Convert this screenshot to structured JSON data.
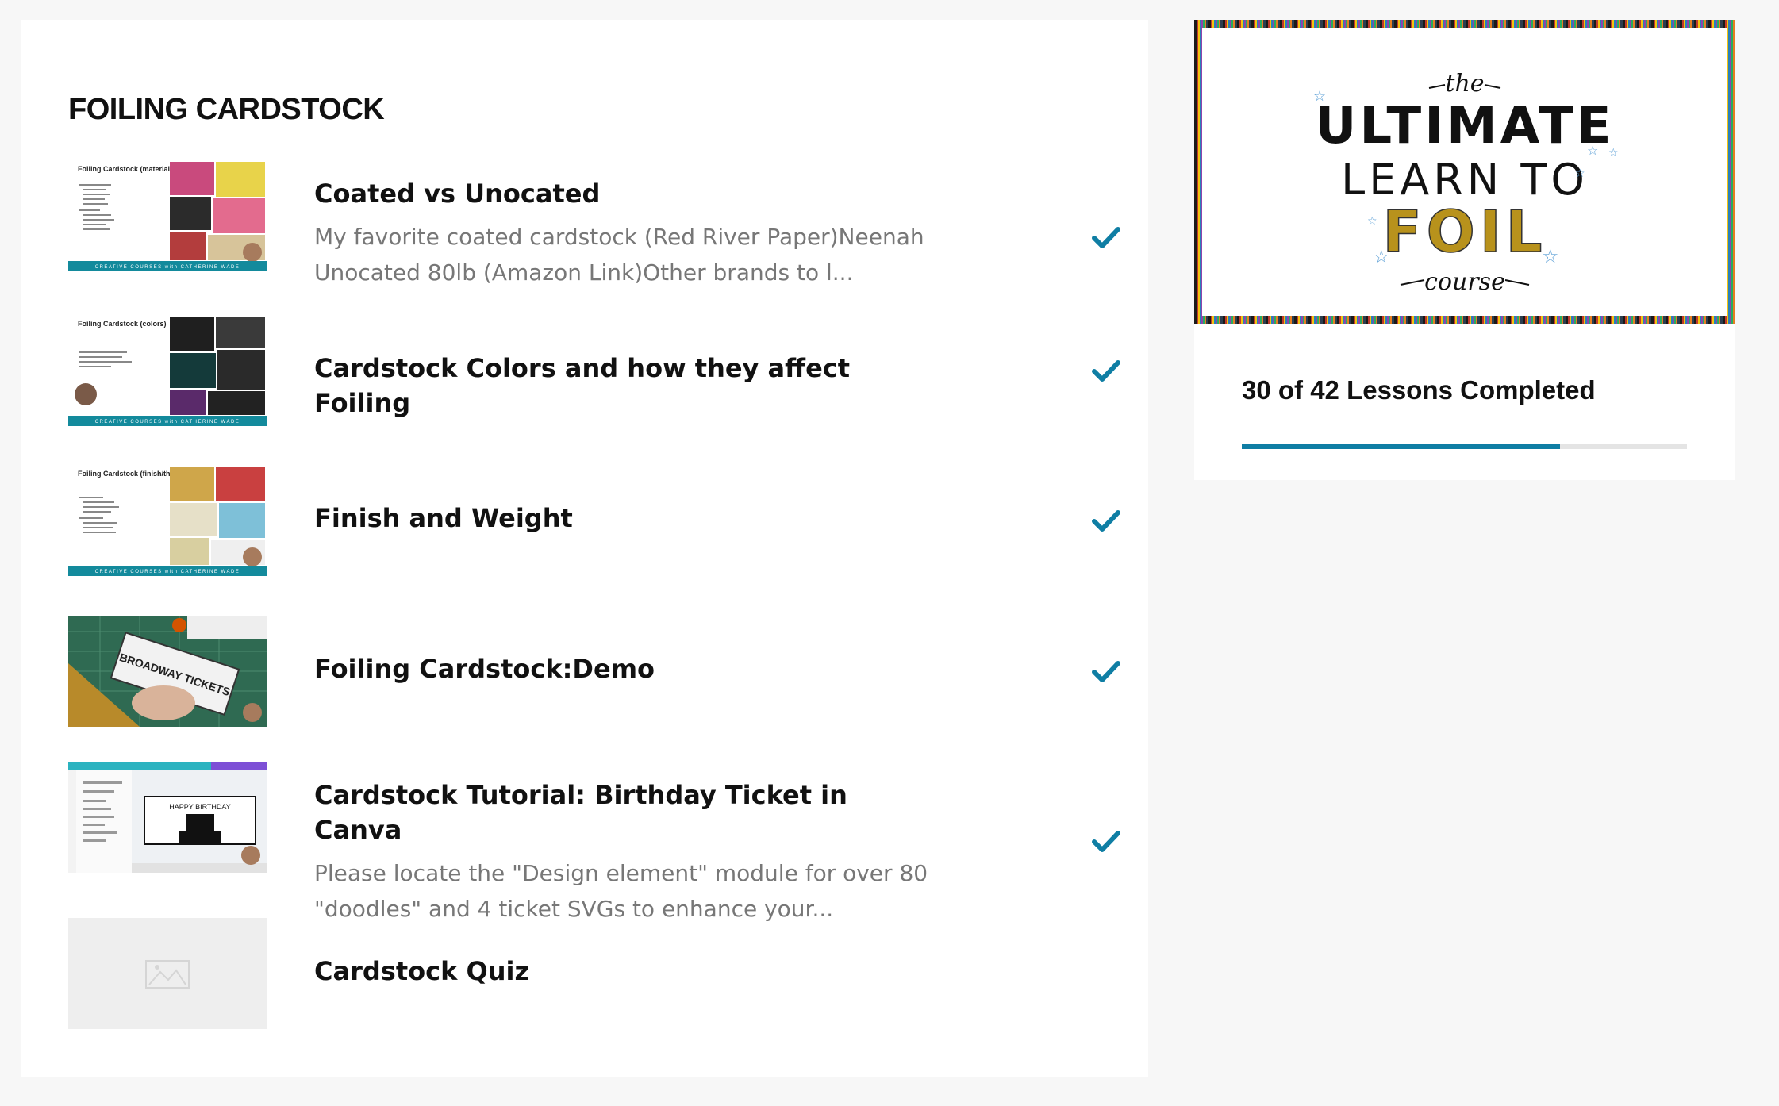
{
  "section": {
    "title": "FOILING CARDSTOCK"
  },
  "lessons": [
    {
      "title": "Coated vs Unocated",
      "description": "My favorite coated cardstock (Red River Paper)Neenah Unocated 80lb (Amazon Link)Other brands to l...",
      "completed": true,
      "thumbnail": {
        "heading": "Foiling Cardstock (material)",
        "footer": "CREATIVE COURSES with CATHERINE WADE"
      }
    },
    {
      "title": "Cardstock Colors and how they affect Foiling",
      "description": "",
      "completed": true,
      "thumbnail": {
        "heading": "Foiling Cardstock (colors)",
        "footer": "CREATIVE COURSES with CATHERINE WADE"
      }
    },
    {
      "title": "Finish and Weight",
      "description": "",
      "completed": true,
      "thumbnail": {
        "heading": "Foiling Cardstock (finish/thickness)",
        "footer": "CREATIVE COURSES with CATHERINE WADE"
      }
    },
    {
      "title": "Foiling Cardstock:Demo",
      "description": "",
      "completed": true,
      "thumbnail": {
        "heading": "",
        "ticket_text": "BROADWAY TICKETS"
      }
    },
    {
      "title": "Cardstock Tutorial: Birthday Ticket in Canva",
      "description": "Please locate the \"Design element\" module for over 80 \"doodles\" and 4 ticket SVGs to enhance your...",
      "completed": true,
      "thumbnail": {
        "heading": "",
        "canvas_text": "HAPPY BIRTHDAY"
      }
    },
    {
      "title": "Cardstock Quiz",
      "description": "",
      "completed": false,
      "thumbnail": {
        "heading": ""
      }
    }
  ],
  "sidebar": {
    "banner": {
      "line1": "the",
      "line2": "ULTIMATE",
      "line3": "LEARN TO",
      "line4": "FOIL",
      "line5": "course"
    },
    "progress": {
      "label": "30 of 42 Lessons Completed",
      "completed": 30,
      "total": 42
    }
  },
  "colors": {
    "accent": "#0f7ea4",
    "check": "#0f7ea4",
    "thumb_footer": "#138a9c"
  },
  "icons": {
    "check": "check-icon",
    "placeholder": "image-placeholder-icon"
  }
}
